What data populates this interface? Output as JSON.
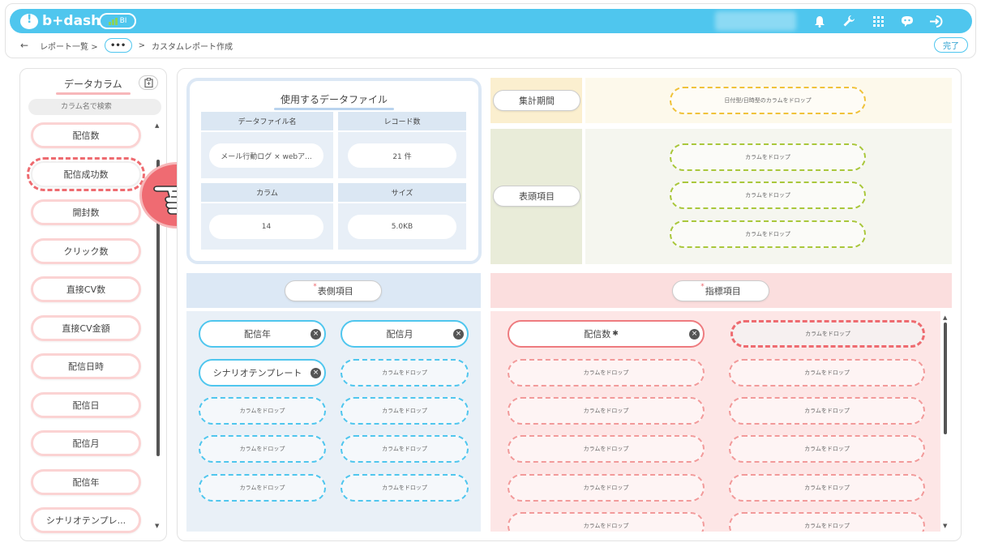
{
  "header": {
    "logo_text": "b+dash",
    "badge_label": "BI",
    "icons": [
      "bell-icon",
      "wrench-icon",
      "grid-icon",
      "chat-bot-icon",
      "logout-icon"
    ]
  },
  "breadcrumb": {
    "back": "←",
    "item1": "レポート一覧 >",
    "more": "•••",
    "sep": ">",
    "current": "カスタムレポート作成"
  },
  "done_label": "完了",
  "left_panel": {
    "title": "データカラム",
    "search_placeholder": "カラム名で検索",
    "items": [
      {
        "label": "配信数"
      },
      {
        "label": "配信成功数"
      },
      {
        "label": "開封数"
      },
      {
        "label": "クリック数"
      },
      {
        "label": "直接CV数"
      },
      {
        "label": "直接CV金額"
      },
      {
        "label": "配信日時"
      },
      {
        "label": "配信日"
      },
      {
        "label": "配信月"
      },
      {
        "label": "配信年"
      },
      {
        "label": "シナリオテンプレ..."
      }
    ],
    "selected_index": 1
  },
  "data_file": {
    "title": "使用するデータファイル",
    "name_label": "データファイル名",
    "name_value": "メール行動ログ × webア...",
    "records_label": "レコード数",
    "records_value": "21 件",
    "columns_label": "カラム",
    "columns_value": "14",
    "size_label": "サイズ",
    "size_value": "5.0KB"
  },
  "period": {
    "label": "集計期間",
    "drop_text": "日付型/日時型のカラムをドロップ"
  },
  "header_items": {
    "label": "表頭項目",
    "drops": [
      "カラムをドロップ",
      "カラムをドロップ",
      "カラムをドロップ"
    ]
  },
  "row_items": {
    "label": "表側項目",
    "required_mark": "*",
    "chips": [
      "配信年",
      "配信月",
      "シナリオテンプレート"
    ],
    "drop_text": "カラムをドロップ"
  },
  "metric_items": {
    "label": "指標項目",
    "required_mark": "*",
    "chip": "配信数",
    "chip_icon": "✱",
    "drop_text": "カラムをドロップ"
  },
  "colors": {
    "accent": "#4fc6ee",
    "pink": "#ee6b70",
    "gold": "#f0c23a",
    "olive": "#a9c73b"
  }
}
